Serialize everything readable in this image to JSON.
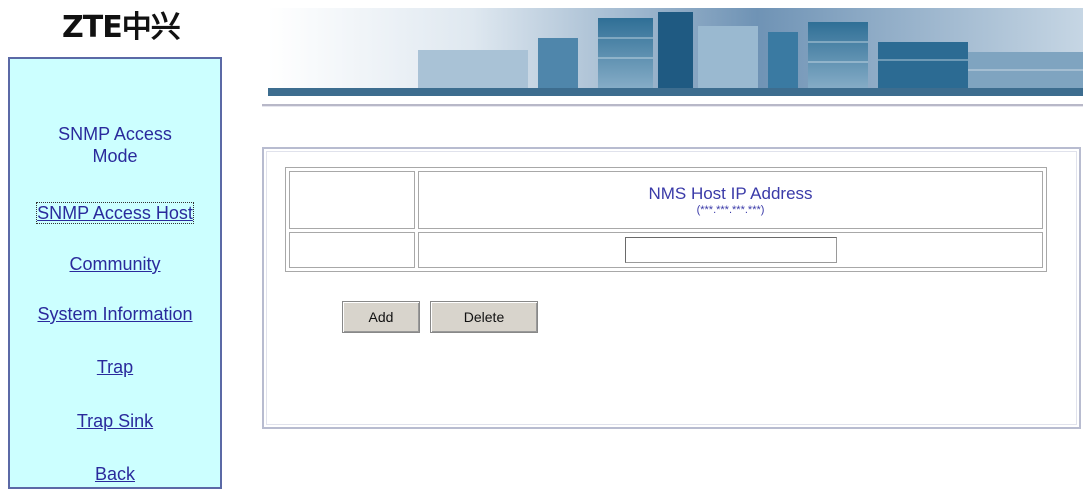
{
  "logo": {
    "text": "ZTE中兴"
  },
  "sidebar": {
    "items": [
      {
        "label": "SNMP Access Mode"
      },
      {
        "label": "SNMP Access Host"
      },
      {
        "label": "Community"
      },
      {
        "label": "System Information"
      },
      {
        "label": "Trap"
      },
      {
        "label": "Trap Sink"
      },
      {
        "label": "Back"
      }
    ]
  },
  "table": {
    "header_title": "NMS Host IP Address",
    "header_format": "(***.***.***.***)",
    "ip_value": ""
  },
  "buttons": {
    "add_label": "Add",
    "delete_label": "Delete"
  },
  "colors": {
    "sidebar_bg": "#ccffff",
    "link": "#2a2a9c",
    "header_text": "#3a3aa8"
  }
}
